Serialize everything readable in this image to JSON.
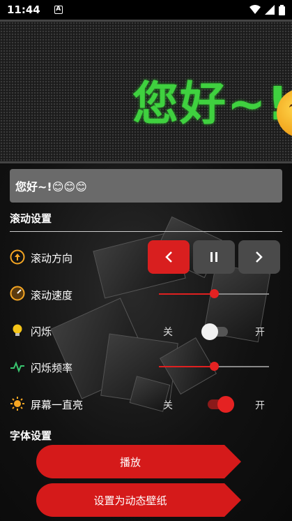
{
  "status_bar": {
    "time": "11:44",
    "notification_icon": "A"
  },
  "led_banner": {
    "text": "您好~!",
    "color": "#3fd13f"
  },
  "input": {
    "value": "您好~!😊😊😊"
  },
  "scroll_settings": {
    "title": "滚动设置",
    "direction_label": "滚动方向",
    "speed_label": "滚动速度",
    "speed_value": 0.5,
    "blink_label": "闪烁",
    "blink_off": "关",
    "blink_on": "开",
    "blink_enabled": false,
    "blink_freq_label": "闪烁频率",
    "blink_freq_value": 0.5,
    "screen_on_label": "屏幕一直亮",
    "screen_on_off": "关",
    "screen_on_on": "开",
    "screen_on_enabled": true
  },
  "font_settings": {
    "title": "字体设置"
  },
  "actions": {
    "play": "播放",
    "set_wallpaper": "设置为动态壁纸"
  },
  "colors": {
    "accent": "#d91f1f",
    "led_green": "#3fd13f"
  }
}
